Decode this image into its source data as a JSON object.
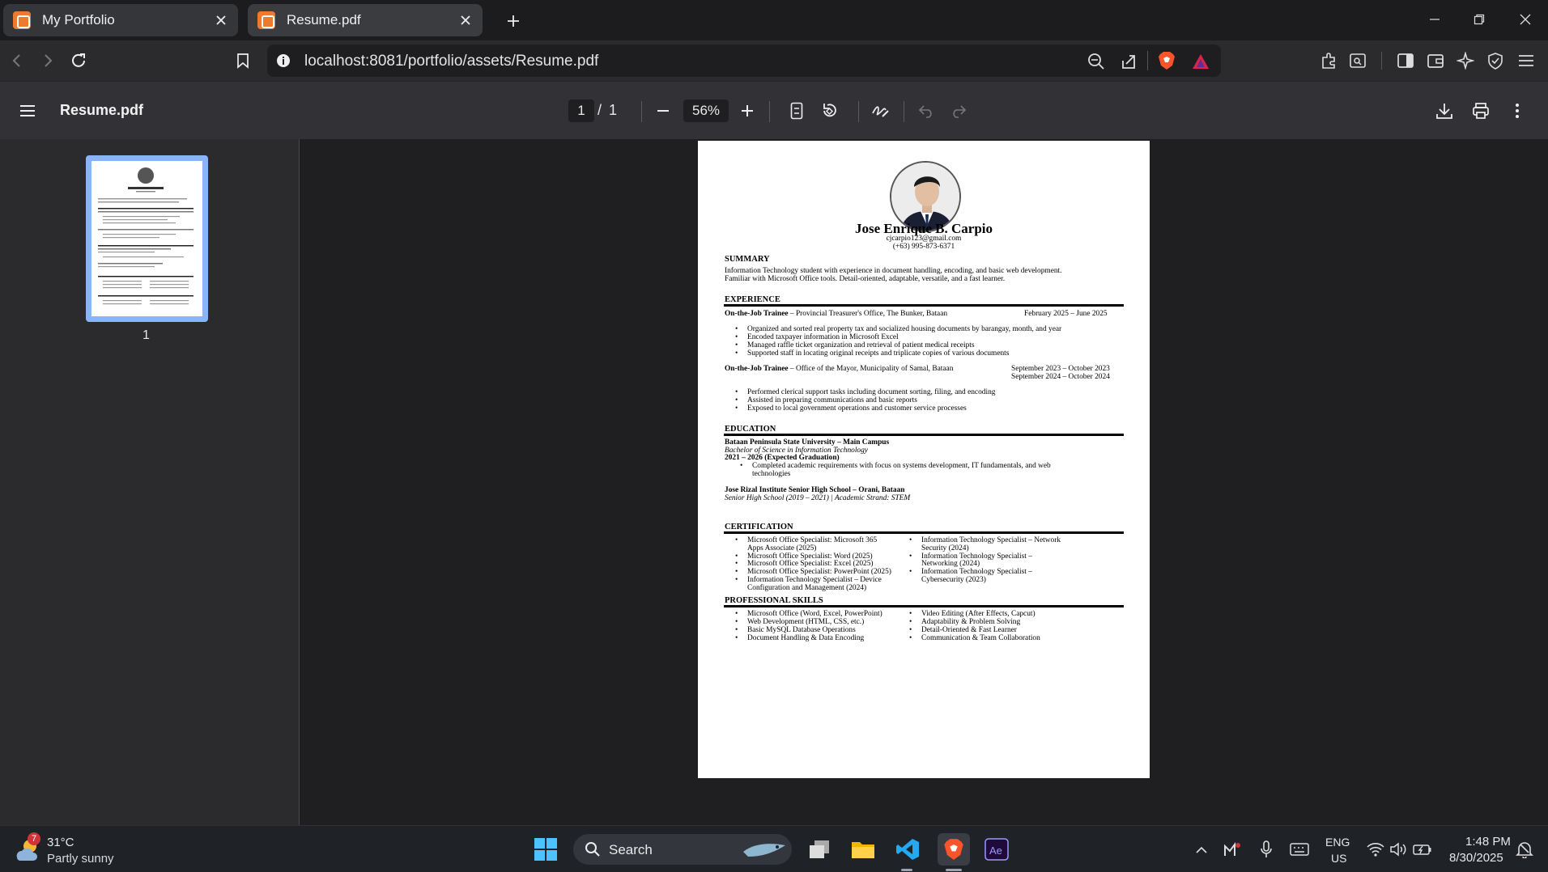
{
  "tabs": [
    {
      "title": "My Portfolio"
    },
    {
      "title": "Resume.pdf"
    }
  ],
  "navbar": {
    "url": "localhost:8081/portfolio/assets/Resume.pdf"
  },
  "pdf_toolbar": {
    "title": "Resume.pdf",
    "page_current": "1",
    "page_separator": "/",
    "page_total": "1",
    "zoom": "56%"
  },
  "thumbnail": {
    "label": "1"
  },
  "resume": {
    "name": "Jose Enrique B. Carpio",
    "email": "cjcarpio123@gmail.com",
    "phone": "(+63) 995-873-6371",
    "summary_heading": "SUMMARY",
    "summary_1": "Information Technology student with experience in document handling, encoding, and basic web development.",
    "summary_2": "Familiar with Microsoft Office tools. Detail-oriented, adaptable, versatile, and a fast learner.",
    "experience_heading": "EXPERIENCE",
    "job1_role": "On-the-Job Trainee",
    "job1_org": " – Provincial Treasurer's Office, The Bunker, Bataan",
    "job1_dates": "February 2025 – June 2025",
    "job1_bullets": [
      "Organized and sorted real property tax and socialized housing documents by barangay, month, and year",
      "Encoded taxpayer information in Microsoft Excel",
      "Managed raffle ticket organization and retrieval of patient medical receipts",
      "Supported staff in locating original receipts and triplicate copies of various documents"
    ],
    "job2_role": "On-the-Job Trainee",
    "job2_org": " – Office of the Mayor, Municipality of Samal, Bataan",
    "job2_dates_1": "September 2023 – October 2023",
    "job2_dates_2": "September 2024 – October 2024",
    "job2_bullets": [
      "Performed clerical support tasks including document sorting, filing, and encoding",
      "Assisted in preparing communications and basic reports",
      "Exposed to local government operations and customer service processes"
    ],
    "education_heading": "EDUCATION",
    "edu1_school": "Bataan Peninsula State University – Main Campus",
    "edu1_degree": "Bachelor of Science in Information Technology",
    "edu1_years": "2021 – 2026 (Expected Graduation)",
    "edu1_bullet_1": "Completed academic requirements with focus on systems development, IT fundamentals, and web",
    "edu1_bullet_2": "technologies",
    "edu2_school": "Jose Rizal Institute Senior High School – Orani, Bataan",
    "edu2_detail": "Senior High School (2019 – 2021) | Academic Strand: STEM",
    "certification_heading": "CERTIFICATION",
    "cert_left": [
      [
        "Microsoft Office Specialist: Microsoft 365",
        "Apps Associate (2025)"
      ],
      [
        "Microsoft Office Specialist: Word (2025)"
      ],
      [
        "Microsoft Office Specialist: Excel (2025)"
      ],
      [
        "Microsoft Office Specialist: PowerPoint (2025)"
      ],
      [
        "Information Technology Specialist – Device",
        "Configuration and Management (2024)"
      ]
    ],
    "cert_right": [
      [
        "Information Technology Specialist – Network",
        "Security (2024)"
      ],
      [
        "Information Technology Specialist –",
        "Networking (2024)"
      ],
      [
        "Information Technology Specialist –",
        "Cybersecurity (2023)"
      ]
    ],
    "skills_heading": "PROFESSIONAL SKILLS",
    "skills_left": [
      "Microsoft Office (Word, Excel, PowerPoint)",
      "Web Development (HTML, CSS, etc.)",
      "Basic MySQL Database Operations",
      "Document Handling & Data Encoding"
    ],
    "skills_right": [
      "Video Editing (After Effects, Capcut)",
      "Adaptability & Problem Solving",
      "Detail-Oriented & Fast Learner",
      "Communication & Team Collaboration"
    ]
  },
  "taskbar": {
    "weather_badge": "7",
    "weather_temp": "31°C",
    "weather_desc": "Partly sunny",
    "search_label": "Search",
    "lang_1": "ENG",
    "lang_2": "US",
    "time": "1:48 PM",
    "date": "8/30/2025"
  },
  "colors": {
    "accent": "#8ab4f8",
    "brave": "#fb542b",
    "favicon": "#ee7a2f"
  }
}
